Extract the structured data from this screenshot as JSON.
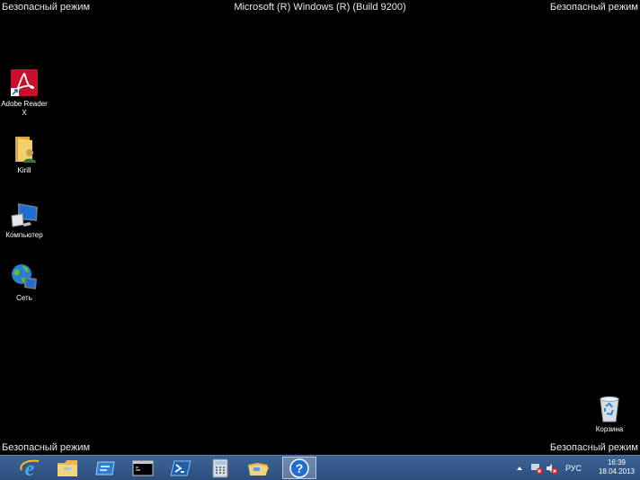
{
  "overlay": {
    "safe_mode_top_left": "Безопасный режим",
    "safe_mode_top_right": "Безопасный режим",
    "safe_mode_bottom_left": "Безопасный режим",
    "safe_mode_bottom_right": "Безопасный режим",
    "build": "Microsoft (R) Windows (R) (Build 9200)"
  },
  "desktop": {
    "icons": [
      {
        "label": "Adobe Reader X",
        "icon": "adobe-reader-icon"
      },
      {
        "label": "Kirill",
        "icon": "user-folder-icon"
      },
      {
        "label": "Компьютер",
        "icon": "computer-icon"
      },
      {
        "label": "Сеть",
        "icon": "network-icon"
      },
      {
        "label": "Корзина",
        "icon": "recycle-bin-icon"
      }
    ]
  },
  "taskbar": {
    "pinned": [
      {
        "icon": "internet-explorer-icon"
      },
      {
        "icon": "file-explorer-icon"
      },
      {
        "icon": "server-manager-icon"
      },
      {
        "icon": "command-prompt-icon"
      },
      {
        "icon": "powershell-icon"
      },
      {
        "icon": "calculator-icon"
      },
      {
        "icon": "folder-icon"
      },
      {
        "icon": "help-icon",
        "active": true
      }
    ],
    "tray": {
      "language": "РУС",
      "time": "16:39",
      "date": "18.04.2013"
    }
  }
}
